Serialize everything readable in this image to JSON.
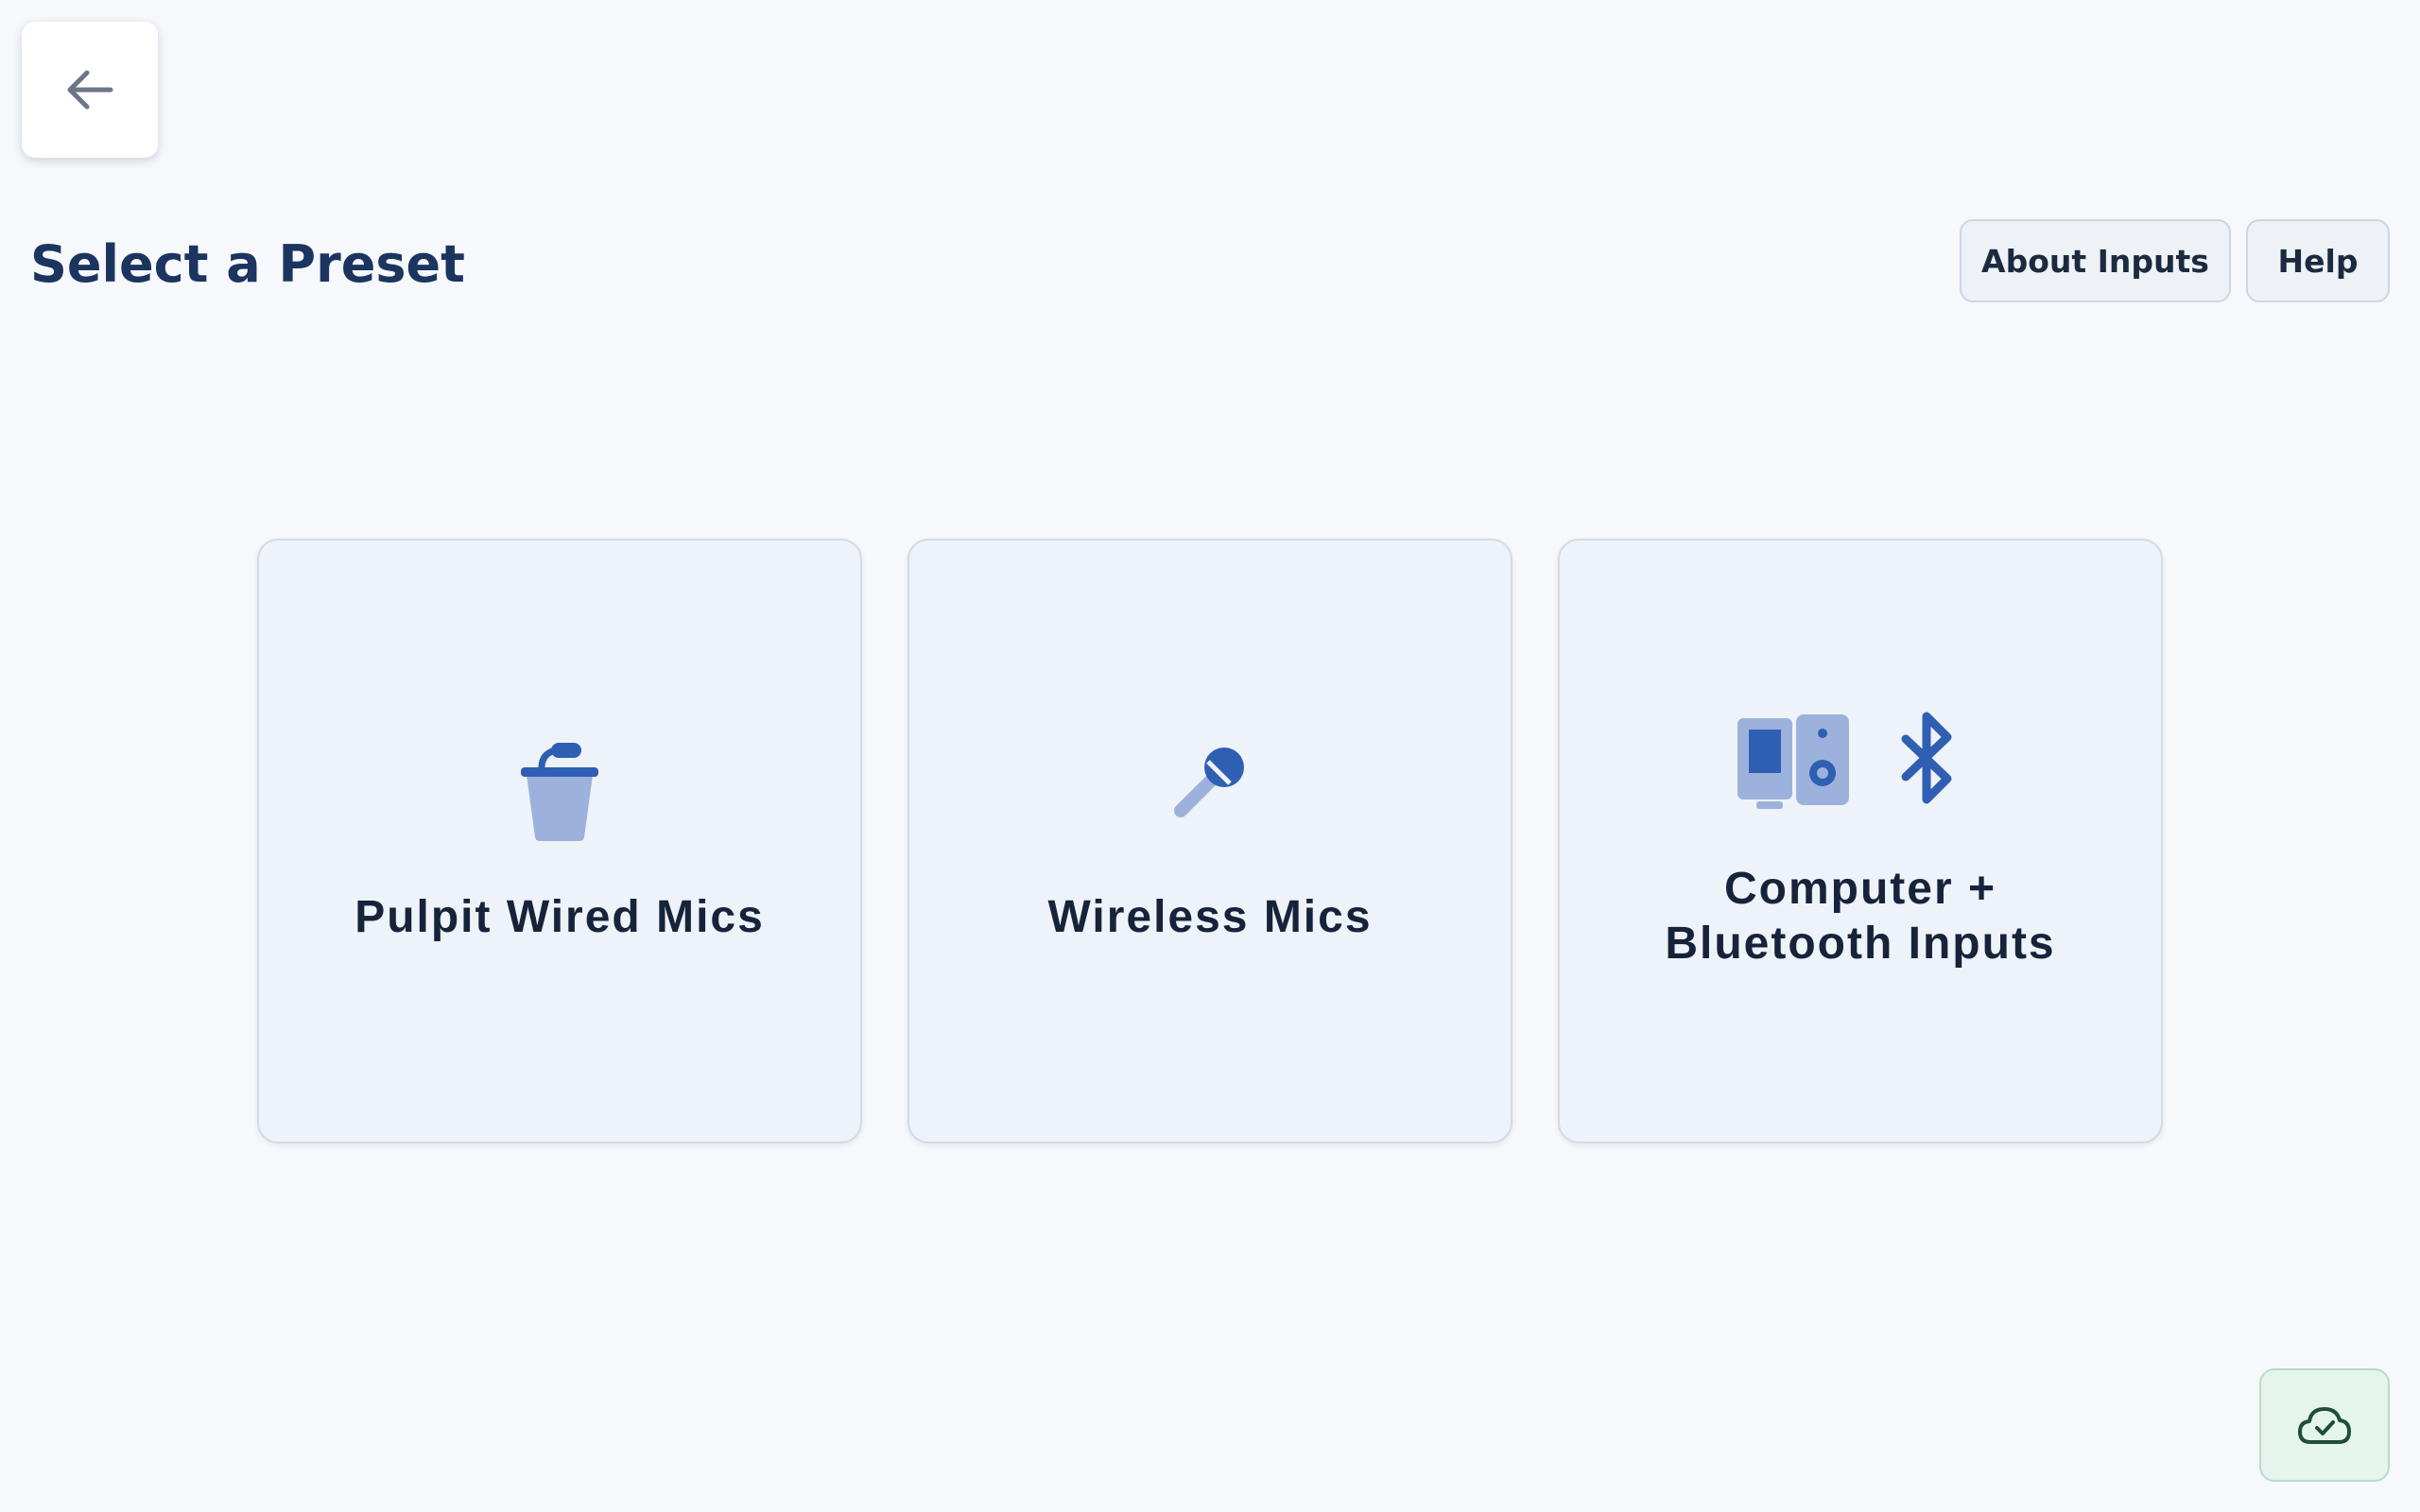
{
  "header": {
    "back_icon": "arrow-left-icon",
    "title": "Select a Preset",
    "about_label": "About Inputs",
    "help_label": "Help"
  },
  "presets": [
    {
      "label": "Pulpit Wired Mics",
      "icon": "pulpit-mic-icon"
    },
    {
      "label": "Wireless Mics",
      "icon": "microphone-icon"
    },
    {
      "label": "Computer +\nBluetooth Inputs",
      "icons": [
        "computer-speaker-icon",
        "bluetooth-icon"
      ]
    }
  ],
  "status": {
    "sync_icon": "cloud-check-icon"
  },
  "colors": {
    "background": "#f6f8fb",
    "title": "#1b3560",
    "card_background": "#eef3f9",
    "icon_primary": "#2f5fb3",
    "icon_light": "#9cb2dc",
    "sync_background": "#e5f4ec"
  }
}
